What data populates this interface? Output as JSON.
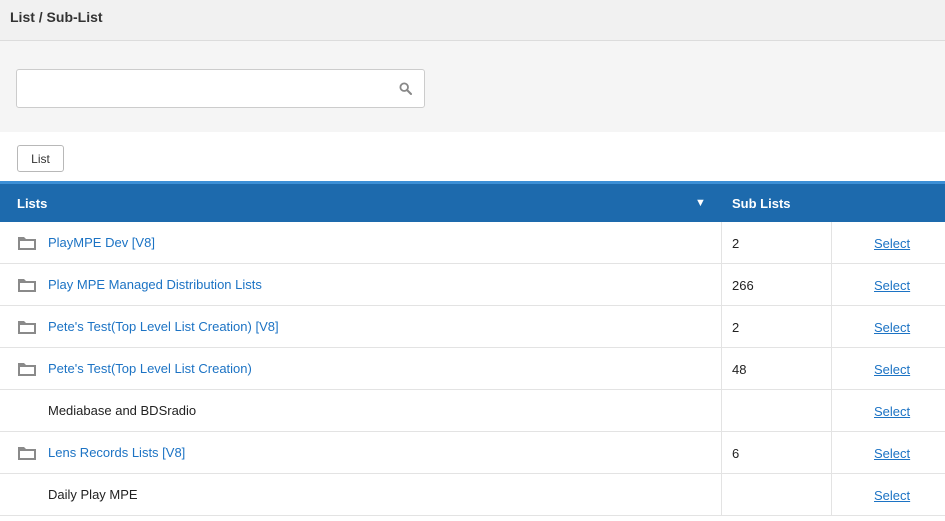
{
  "header": {
    "title": "List / Sub-List"
  },
  "search": {
    "placeholder": "",
    "value": "",
    "icon": "search-icon"
  },
  "toolbar": {
    "list_button_label": "List"
  },
  "table": {
    "columns": {
      "lists": "Lists",
      "sort_indicator": "▼",
      "sub_lists": "Sub Lists"
    },
    "rows": [
      {
        "name": "PlayMPE Dev [V8]",
        "sub_lists": "2",
        "action": "Select",
        "has_folder": true
      },
      {
        "name": "Play MPE Managed Distribution Lists",
        "sub_lists": "266",
        "action": "Select",
        "has_folder": true
      },
      {
        "name": "Pete's Test(Top Level List Creation) [V8]",
        "sub_lists": "2",
        "action": "Select",
        "has_folder": true
      },
      {
        "name": "Pete's Test(Top Level List Creation)",
        "sub_lists": "48",
        "action": "Select",
        "has_folder": true
      },
      {
        "name": "Mediabase and BDSradio",
        "sub_lists": "",
        "action": "Select",
        "has_folder": false
      },
      {
        "name": "Lens Records Lists [V8]",
        "sub_lists": "6",
        "action": "Select",
        "has_folder": true
      },
      {
        "name": "Daily Play MPE",
        "sub_lists": "",
        "action": "Select",
        "has_folder": false
      }
    ]
  },
  "colors": {
    "header_blue": "#1d6aad",
    "link_blue": "#1c73c4"
  }
}
